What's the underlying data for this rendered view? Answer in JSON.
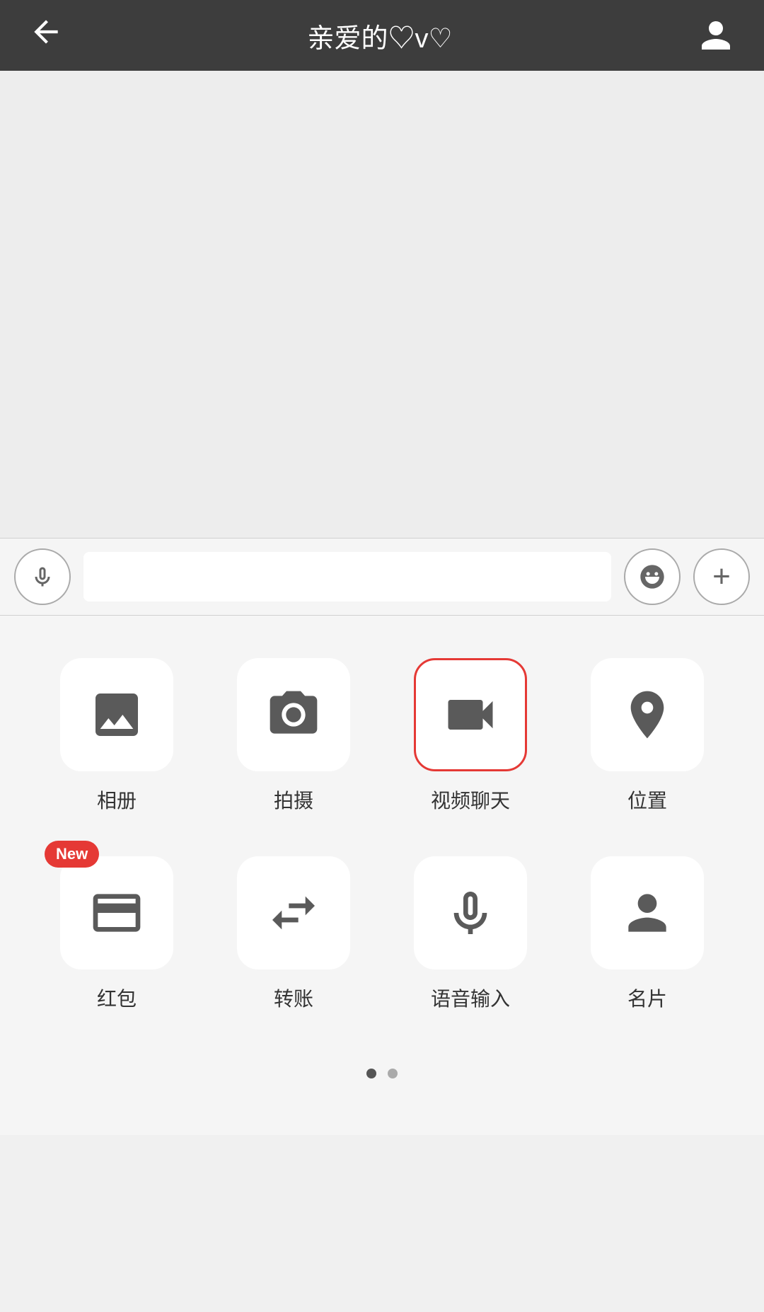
{
  "header": {
    "back_label": "←",
    "title": "亲爱的♡v♡"
  },
  "input_bar": {
    "placeholder": ""
  },
  "grid": {
    "rows": [
      [
        {
          "id": "album",
          "label": "相册",
          "icon": "image",
          "highlighted": false,
          "new": false
        },
        {
          "id": "camera",
          "label": "拍摄",
          "icon": "camera",
          "highlighted": false,
          "new": false
        },
        {
          "id": "video",
          "label": "视频聊天",
          "icon": "video",
          "highlighted": true,
          "new": false
        },
        {
          "id": "location",
          "label": "位置",
          "icon": "location",
          "highlighted": false,
          "new": false
        }
      ],
      [
        {
          "id": "redpacket",
          "label": "红包",
          "icon": "redpacket",
          "highlighted": false,
          "new": true
        },
        {
          "id": "transfer",
          "label": "转账",
          "icon": "transfer",
          "highlighted": false,
          "new": false
        },
        {
          "id": "voice",
          "label": "语音输入",
          "icon": "microphone",
          "highlighted": false,
          "new": false
        },
        {
          "id": "card",
          "label": "名片",
          "icon": "contact",
          "highlighted": false,
          "new": false
        }
      ]
    ],
    "new_badge_label": "New"
  },
  "page_indicator": {
    "current": 0,
    "total": 2
  }
}
